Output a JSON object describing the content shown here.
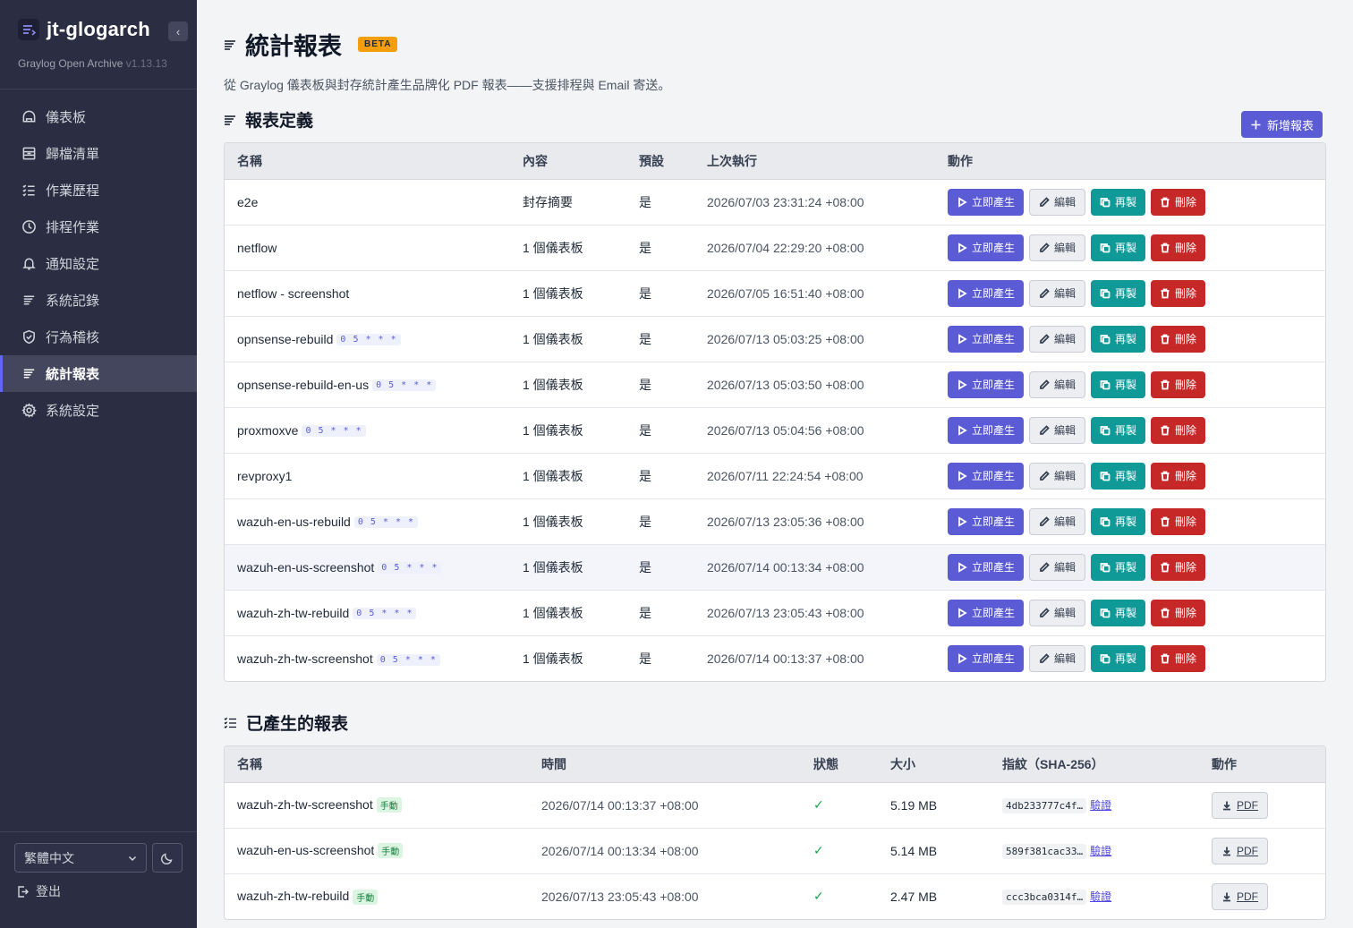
{
  "sidebar": {
    "app_name": "jt-glogarch",
    "subtitle": "Graylog Open Archive",
    "version": "v1.13.13",
    "collapse_glyph": "‹",
    "items": [
      {
        "label": "儀表板",
        "icon": "home-icon"
      },
      {
        "label": "歸檔清單",
        "icon": "archive-icon"
      },
      {
        "label": "作業歷程",
        "icon": "list-check-icon"
      },
      {
        "label": "排程作業",
        "icon": "clock-icon"
      },
      {
        "label": "通知設定",
        "icon": "bell-icon"
      },
      {
        "label": "系統記錄",
        "icon": "lines-icon"
      },
      {
        "label": "行為稽核",
        "icon": "shield-check-icon"
      },
      {
        "label": "統計報表",
        "icon": "lines-icon",
        "active": true
      },
      {
        "label": "系統設定",
        "icon": "gear-icon"
      }
    ],
    "language": "繁體中文",
    "logout": "登出"
  },
  "page": {
    "title": "統計報表",
    "badge": "BETA",
    "description": "從 Graylog 儀表板與封存統計產生品牌化 PDF 報表——支援排程與 Email 寄送。"
  },
  "definitions": {
    "title": "報表定義",
    "add_button": "新增報表",
    "columns": [
      "名稱",
      "內容",
      "預設",
      "上次執行",
      "動作"
    ],
    "actions": {
      "generate": "立即產生",
      "edit": "編輯",
      "copy": "再製",
      "delete": "刪除"
    },
    "rows": [
      {
        "name": "e2e",
        "schedule": "",
        "content": "封存摘要",
        "default": "是",
        "last_run": "2026/07/03 23:31:24 +08:00"
      },
      {
        "name": "netflow",
        "schedule": "",
        "content": "1 個儀表板",
        "default": "是",
        "last_run": "2026/07/04 22:29:20 +08:00"
      },
      {
        "name": "netflow - screenshot",
        "schedule": "",
        "content": "1 個儀表板",
        "default": "是",
        "last_run": "2026/07/05 16:51:40 +08:00"
      },
      {
        "name": "opnsense-rebuild",
        "schedule": "0 5 * * *",
        "content": "1 個儀表板",
        "default": "是",
        "last_run": "2026/07/13 05:03:25 +08:00"
      },
      {
        "name": "opnsense-rebuild-en-us",
        "schedule": "0 5 * * *",
        "content": "1 個儀表板",
        "default": "是",
        "last_run": "2026/07/13 05:03:50 +08:00"
      },
      {
        "name": "proxmoxve",
        "schedule": "0 5 * * *",
        "content": "1 個儀表板",
        "default": "是",
        "last_run": "2026/07/13 05:04:56 +08:00"
      },
      {
        "name": "revproxy1",
        "schedule": "",
        "content": "1 個儀表板",
        "default": "是",
        "last_run": "2026/07/11 22:24:54 +08:00"
      },
      {
        "name": "wazuh-en-us-rebuild",
        "schedule": "0 5 * * *",
        "content": "1 個儀表板",
        "default": "是",
        "last_run": "2026/07/13 23:05:36 +08:00"
      },
      {
        "name": "wazuh-en-us-screenshot",
        "schedule": "0 5 * * *",
        "content": "1 個儀表板",
        "default": "是",
        "last_run": "2026/07/14 00:13:34 +08:00",
        "highlight": true
      },
      {
        "name": "wazuh-zh-tw-rebuild",
        "schedule": "0 5 * * *",
        "content": "1 個儀表板",
        "default": "是",
        "last_run": "2026/07/13 23:05:43 +08:00"
      },
      {
        "name": "wazuh-zh-tw-screenshot",
        "schedule": "0 5 * * *",
        "content": "1 個儀表板",
        "default": "是",
        "last_run": "2026/07/14 00:13:37 +08:00"
      }
    ]
  },
  "generated": {
    "title": "已產生的報表",
    "columns": [
      "名稱",
      "時間",
      "狀態",
      "大小",
      "指紋（SHA-256）",
      "動作"
    ],
    "verify_label": "驗證",
    "pdf_label": "PDF",
    "status_glyph": "✓",
    "rows": [
      {
        "name": "wazuh-zh-tw-screenshot",
        "tag": "手動",
        "time": "2026/07/14 00:13:37 +08:00",
        "size": "5.19 MB",
        "hash": "4db233777c4f…"
      },
      {
        "name": "wazuh-en-us-screenshot",
        "tag": "手動",
        "time": "2026/07/14 00:13:34 +08:00",
        "size": "5.14 MB",
        "hash": "589f381cac33…"
      },
      {
        "name": "wazuh-zh-tw-rebuild",
        "tag": "手動",
        "time": "2026/07/13 23:05:43 +08:00",
        "size": "2.47 MB",
        "hash": "ccc3bca0314f…"
      }
    ]
  },
  "colors": {
    "accent": "#5b5bd6",
    "sidebar": "#2b2d42",
    "copy": "#0f9a98",
    "delete": "#c62828",
    "beta": "#f59e0b"
  }
}
